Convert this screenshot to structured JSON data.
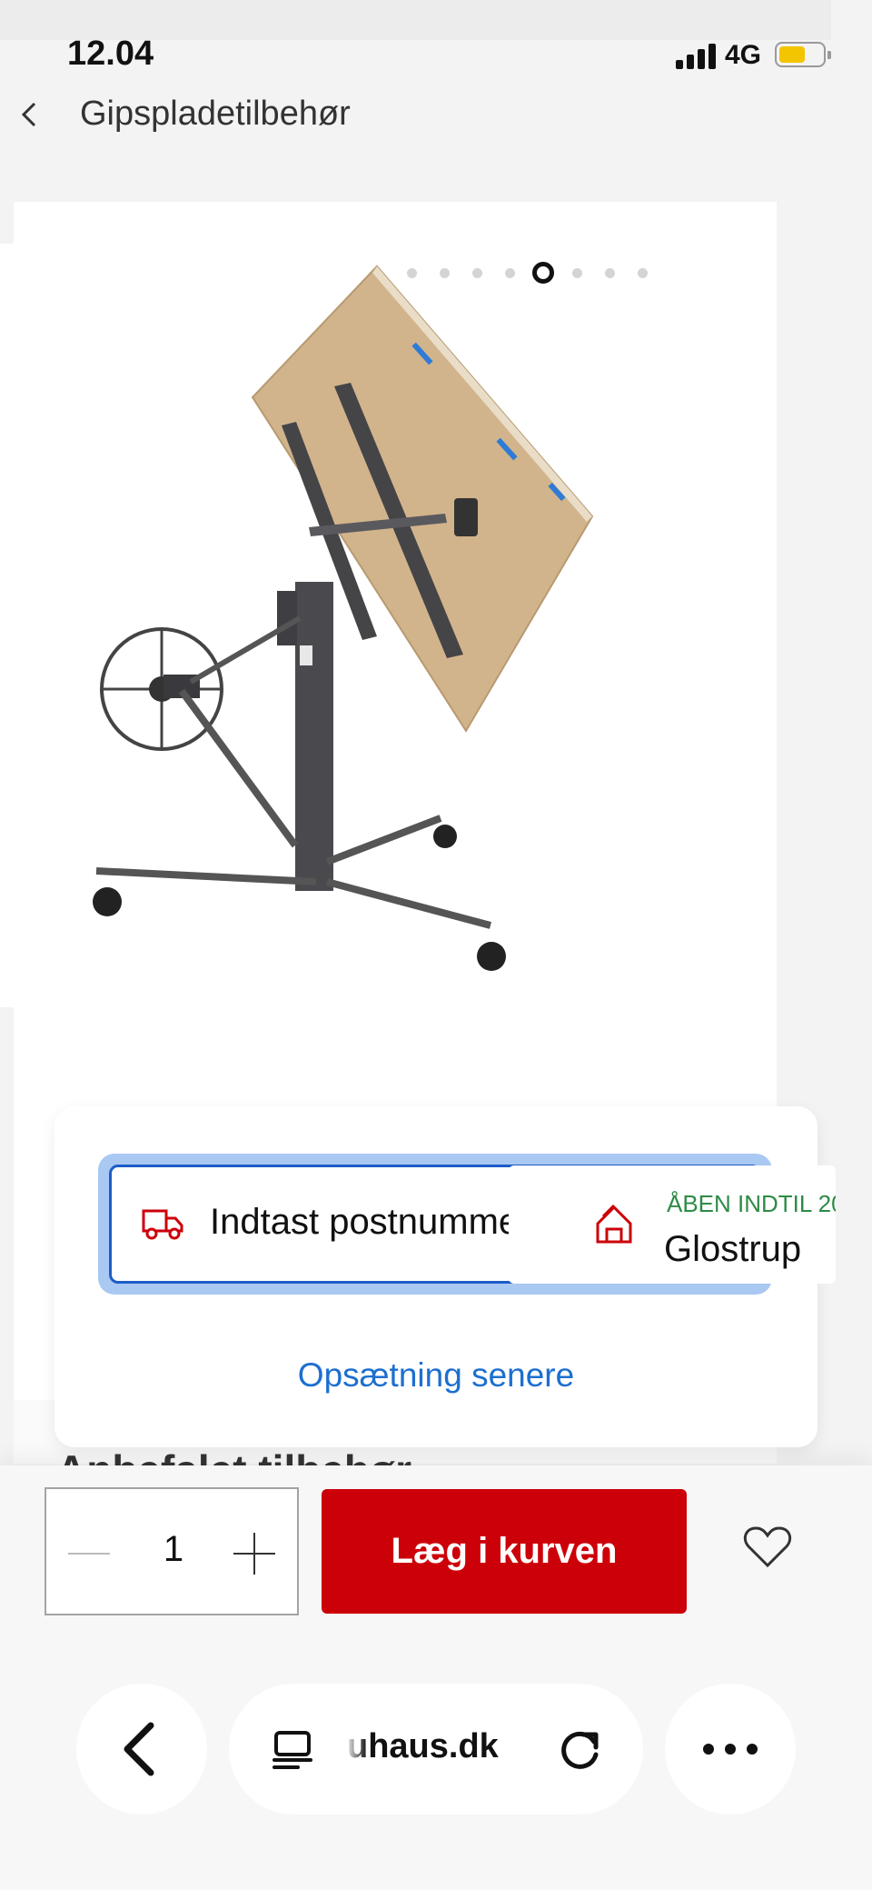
{
  "status_bar": {
    "time": "12.04",
    "network": "4G"
  },
  "header": {
    "back_icon": "chevron-left-icon",
    "title": "Gipspladetilbehør"
  },
  "gallery": {
    "dot_count": 8,
    "active_index": 4
  },
  "delivery_modal": {
    "postcode_label": "Indtast postnummer",
    "store_status": "ÅBEN INDTIL 20",
    "store_name": "Glostrup",
    "later_link": "Opsætning senere"
  },
  "cut_heading": "Anbefalet tilbehør",
  "purchase": {
    "quantity": "1",
    "add_to_cart_label": "Læg i kurven"
  },
  "browser": {
    "url": "uhaus.dk"
  },
  "colors": {
    "brand_red": "#cc0008",
    "link_blue": "#1d6fcf",
    "open_green": "#2e8b46",
    "focus_blue": "#1e5cc8"
  }
}
